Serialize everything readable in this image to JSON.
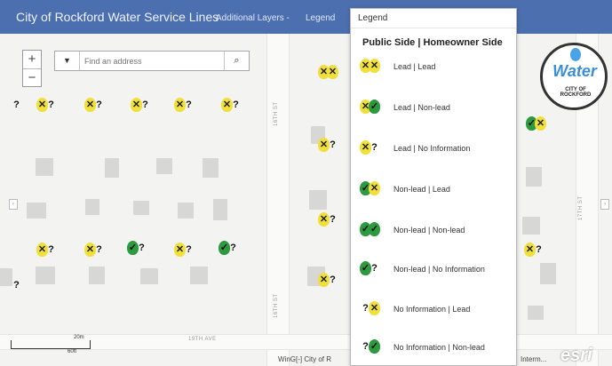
{
  "header": {
    "title": "City of Rockford Water Service Lines",
    "additional_layers": "Additional Layers -",
    "legend": "Legend"
  },
  "search": {
    "placeholder": "Find an address",
    "dropdown_icon": "caret-down-icon",
    "button_icon": "search-icon"
  },
  "zoom": {
    "in": "+",
    "out": "−"
  },
  "logo": {
    "brand": "Water",
    "city": "CITY OF ROCKFORD"
  },
  "streets": {
    "s16th_a": "16TH ST",
    "s16th_b": "16TH ST",
    "s17th": "17TH ST",
    "ave19th": "19TH AVE"
  },
  "legend": {
    "header": "Legend",
    "subtitle": "Public Side | Homeowner Side",
    "items": [
      {
        "label": "Lead | Lead",
        "public": "lead",
        "homeowner": "lead"
      },
      {
        "label": "Lead | Non-lead",
        "public": "lead",
        "homeowner": "non-lead"
      },
      {
        "label": "Lead | No Information",
        "public": "lead",
        "homeowner": "no-information"
      },
      {
        "label": "Non-lead | Lead",
        "public": "non-lead",
        "homeowner": "lead"
      },
      {
        "label": "Non-lead | Non-lead",
        "public": "non-lead",
        "homeowner": "non-lead"
      },
      {
        "label": "Non-lead | No Information",
        "public": "non-lead",
        "homeowner": "no-information"
      },
      {
        "label": "No Information | Lead",
        "public": "no-information",
        "homeowner": "lead"
      },
      {
        "label": "No Information | Non-lead",
        "public": "no-information",
        "homeowner": "non-lead"
      }
    ]
  },
  "scale": {
    "metric": "20m",
    "imperial": "60ft"
  },
  "attribution": {
    "left": "WinG[-] City of R",
    "right": "Interm..."
  },
  "esri": "esri",
  "colors": {
    "header": "#4c6fb0",
    "lead": "#f1df3a",
    "non_lead": "#2c9a3e"
  }
}
